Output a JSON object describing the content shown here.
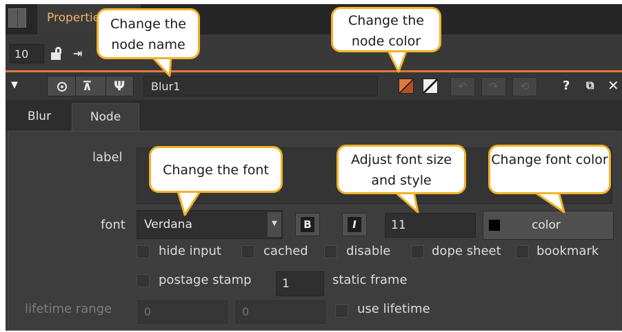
{
  "window": {
    "title": "Properties",
    "node_count": "10"
  },
  "node": {
    "name": "Blur1"
  },
  "tabs": [
    {
      "label": "Blur"
    },
    {
      "label": "Node"
    }
  ],
  "form": {
    "label_label": "label",
    "font_label": "font",
    "font_value": "Verdana",
    "font_size_value": "11",
    "color_button_label": "color",
    "checkboxes": {
      "hide_input": "hide input",
      "cached": "cached",
      "disable": "disable",
      "dope_sheet": "dope sheet",
      "bookmark": "bookmark",
      "postage_stamp": "postage stamp"
    },
    "static_frame_value": "1",
    "static_frame_label": "static frame",
    "lifetime_range_label": "lifetime range",
    "lifetime_start": "0",
    "lifetime_end": "0",
    "use_lifetime_label": "use lifetime"
  },
  "callouts": {
    "node_name": "Change the node name",
    "node_color": "Change the node color",
    "font": "Change the font",
    "font_size": "Adjust font size and style",
    "font_color": "Change font color"
  },
  "colors": {
    "accent_orange": "#e0793a",
    "callout_border": "#f1b229",
    "node_color_swatch": "#c8602a",
    "panel_bg": "#393939"
  }
}
